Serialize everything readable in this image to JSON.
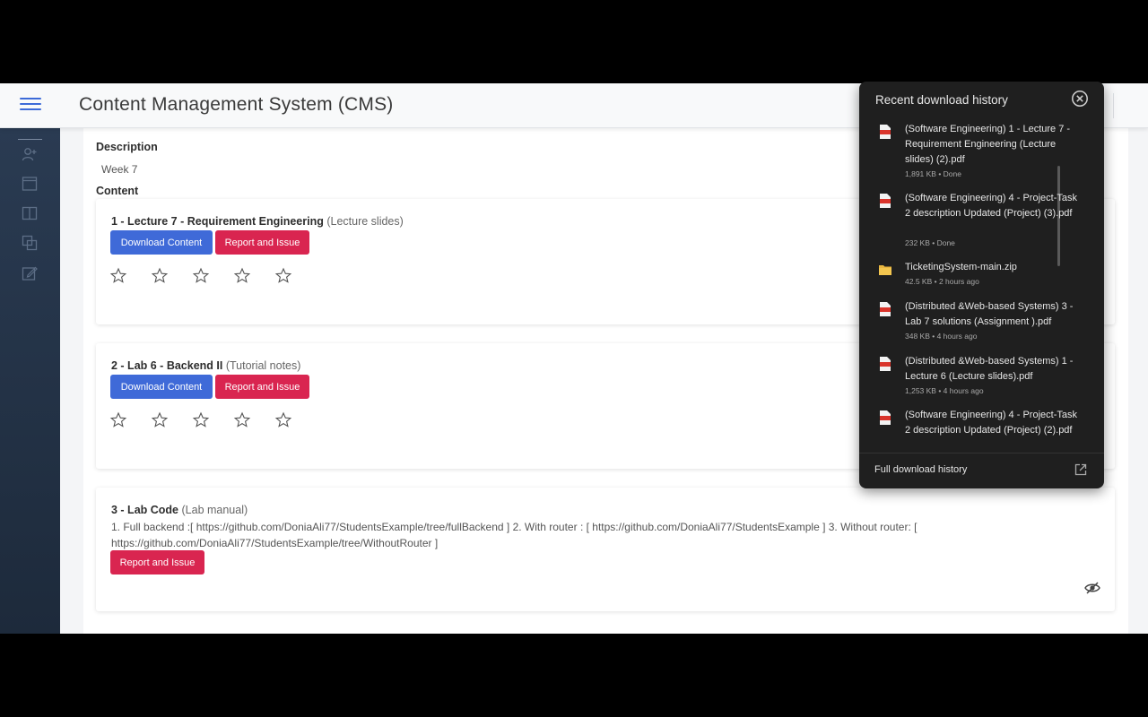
{
  "header": {
    "title": "Content Management System (CMS)"
  },
  "main": {
    "description_label": "Description",
    "description_value": "Week 7",
    "content_label": "Content",
    "items": [
      {
        "title": "1 - Lecture 7 - Requirement Engineering",
        "kind": "(Lecture slides)",
        "download_label": "Download Content",
        "report_label": "Report and Issue",
        "rating": 0
      },
      {
        "title": "2 - Lab 6 - Backend II",
        "kind": "(Tutorial notes)",
        "download_label": "Download Content",
        "report_label": "Report and Issue",
        "rating": 0
      },
      {
        "title": "3 - Lab Code",
        "kind": "(Lab manual)",
        "body": "1. Full backend :[ https://github.com/DoniaAli77/StudentsExample/tree/fullBackend ] 2. With router : [ https://github.com/DoniaAli77/StudentsExample ] 3. Without router: [ https://github.com/DoniaAli77/StudentsExample/tree/WithoutRouter ]",
        "report_label": "Report and Issue"
      }
    ]
  },
  "downloads": {
    "title": "Recent download history",
    "footer_label": "Full download history",
    "items": [
      {
        "name": "(Software Engineering) 1 - Lecture 7 - Requirement Engineering (Lecture slides) (2).pdf",
        "meta": "1,891 KB • Done",
        "icon": "pdf-file-icon"
      },
      {
        "name": "(Software Engineering) 4 - Project-Task 2 description Updated (Project) (3).pdf",
        "meta": "232 KB • Done",
        "icon": "pdf-file-icon"
      },
      {
        "name": "TicketingSystem-main.zip",
        "meta": "42.5 KB • 2 hours ago",
        "icon": "zip-folder-icon"
      },
      {
        "name": "(Distributed &Web-based Systems) 3 - Lab 7 solutions (Assignment ).pdf",
        "meta": "348 KB • 4 hours ago",
        "icon": "pdf-file-icon"
      },
      {
        "name": "(Distributed &Web-based Systems) 1 - Lecture 6 (Lecture slides).pdf",
        "meta": "1,253 KB • 4 hours ago",
        "icon": "pdf-file-icon"
      },
      {
        "name": "(Software Engineering) 4 - Project-Task 2 description Updated (Project) (2).pdf",
        "meta": "",
        "icon": "pdf-file-icon"
      }
    ]
  },
  "colors": {
    "primary": "#3f6ad8",
    "danger": "#d92550",
    "sidebar": "#2a3b52",
    "panel": "#1f1f1f"
  }
}
